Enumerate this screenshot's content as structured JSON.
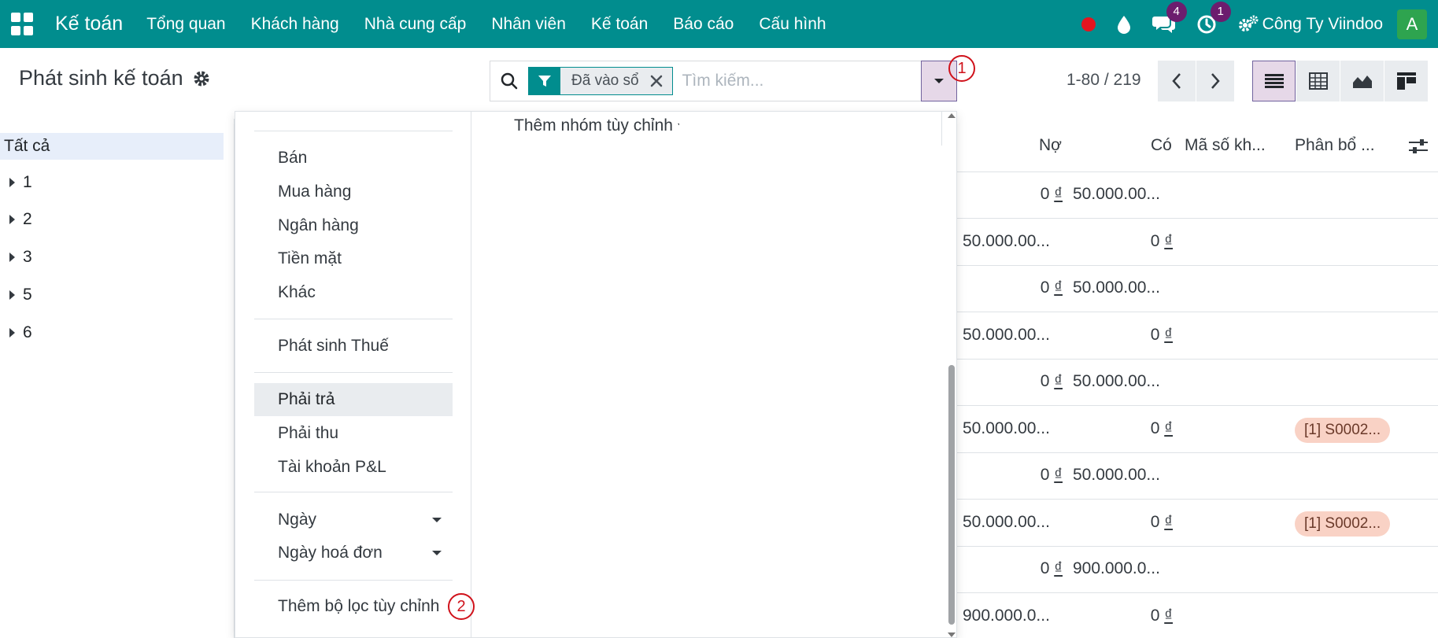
{
  "navbar": {
    "brand": "Kế toán",
    "menu": [
      "Tổng quan",
      "Khách hàng",
      "Nhà cung cấp",
      "Nhân viên",
      "Kế toán",
      "Báo cáo",
      "Cấu hình"
    ],
    "chat_badge": "4",
    "activity_badge": "1",
    "company": "Công Ty Viindoo",
    "avatar_letter": "A",
    "icons": [
      "apps-grid-icon",
      "status-dot-icon",
      "droplet-icon",
      "chat-icon",
      "clock-icon",
      "settings-cogs-icon"
    ]
  },
  "control_panel": {
    "title": "Phát sinh kế toán",
    "search": {
      "facet_label": "Đã vào sổ",
      "placeholder": "Tìm kiếm..."
    },
    "callout_1": "1",
    "callout_2": "2",
    "pager": "1-80 / 219"
  },
  "side_panel": {
    "all_label": "Tất cả",
    "items": [
      "1",
      "2",
      "3",
      "5",
      "6"
    ]
  },
  "filters": {
    "journals": [
      "Bán",
      "Mua hàng",
      "Ngân hàng",
      "Tiền mặt",
      "Khác"
    ],
    "tax": "Phát sinh Thuế",
    "accounts": [
      "Phải trả",
      "Phải thu",
      "Tài khoản P&L"
    ],
    "dates": [
      "Ngày",
      "Ngày hoá đơn"
    ],
    "custom": "Thêm bộ lọc tùy chỉnh"
  },
  "group_by": {
    "custom_label": "Thêm nhóm tùy chỉnh"
  },
  "table": {
    "headers": {
      "debit": "Nợ",
      "credit": "Có",
      "tax_code": "Mã số kh...",
      "allocation": "Phân bổ ..."
    },
    "rows": [
      {
        "debit": "0",
        "credit": "50.000.00...",
        "tag": ""
      },
      {
        "debit": "50.000.00...",
        "credit": "0",
        "tag": ""
      },
      {
        "debit": "0",
        "credit": "50.000.00...",
        "tag": ""
      },
      {
        "debit": "50.000.00...",
        "credit": "0",
        "tag": ""
      },
      {
        "debit": "0",
        "credit": "50.000.00...",
        "tag": ""
      },
      {
        "debit": "50.000.00...",
        "credit": "0",
        "tag": "[1] S0002..."
      },
      {
        "debit": "0",
        "credit": "50.000.00...",
        "tag": ""
      },
      {
        "debit": "50.000.00...",
        "credit": "0",
        "tag": "[1] S0002..."
      },
      {
        "debit": "0",
        "credit": "900.000.0...",
        "tag": ""
      },
      {
        "debit": "900.000.0...",
        "credit": "0",
        "tag": ""
      }
    ],
    "currency": "₫"
  },
  "colors": {
    "navbar": "#018d8e",
    "accent": "#71639e",
    "badge": "#6c1d6e",
    "callout": "#d0121b",
    "tag": "#f9d2c5"
  }
}
